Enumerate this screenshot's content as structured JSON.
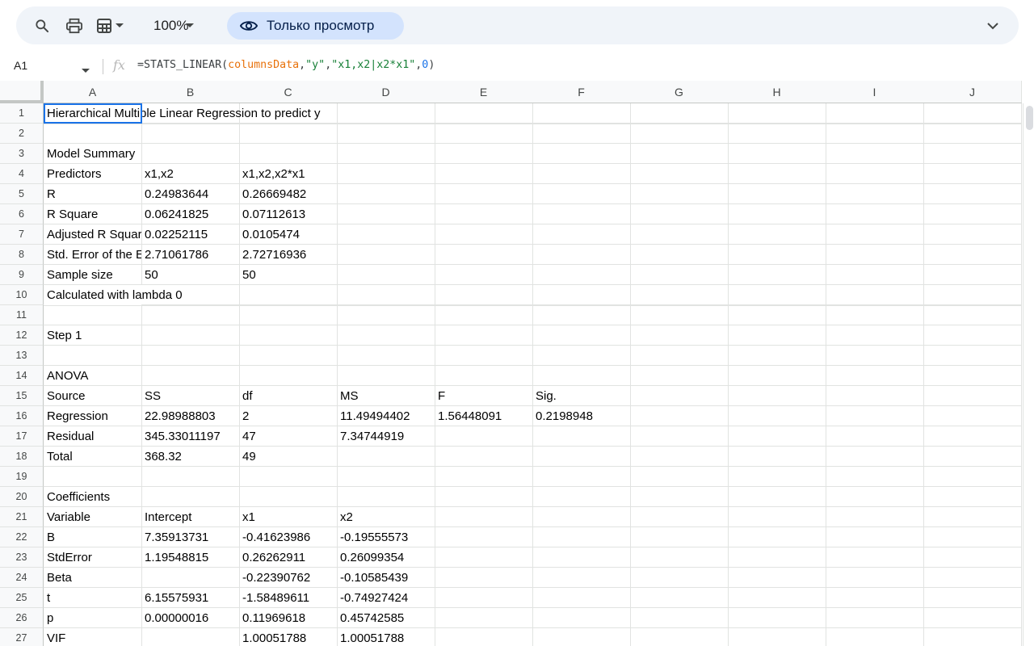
{
  "toolbar": {
    "zoom": "100%",
    "view_mode": "Только просмотр",
    "icons": [
      "search-icon",
      "print-icon",
      "format-icon",
      "chevron-down-icon"
    ]
  },
  "formula_bar": {
    "cell_ref": "A1",
    "fx": "fx",
    "formula": {
      "prefix": "=STATS_LINEAR(",
      "arg1": "columnsData",
      "sep1": ",",
      "arg2": "\"y\"",
      "sep2": ",",
      "arg3": "\"x1,x2|x2*x1\"",
      "sep3": ",",
      "arg4": "0",
      "suffix": ")"
    }
  },
  "columns": [
    "A",
    "B",
    "C",
    "D",
    "E",
    "F",
    "G",
    "H",
    "I",
    "J"
  ],
  "rows": [
    {
      "n": "1",
      "cells": [
        "Hierarchical  Multiple Linear Regression to predict y",
        "",
        "",
        "",
        "",
        ""
      ]
    },
    {
      "n": "2",
      "cells": [
        "",
        "",
        "",
        "",
        "",
        ""
      ]
    },
    {
      "n": "3",
      "cells": [
        "Model Summary",
        "",
        "",
        "",
        "",
        ""
      ]
    },
    {
      "n": "4",
      "cells": [
        "Predictors",
        "x1,x2",
        "x1,x2,x2*x1",
        "",
        "",
        ""
      ]
    },
    {
      "n": "5",
      "cells": [
        "R",
        "0.24983644",
        "0.26669482",
        "",
        "",
        ""
      ]
    },
    {
      "n": "6",
      "cells": [
        "R Square",
        "0.06241825",
        "0.07112613",
        "",
        "",
        ""
      ]
    },
    {
      "n": "7",
      "cells": [
        "Adjusted R Square",
        "0.02252115",
        "0.0105474",
        "",
        "",
        ""
      ]
    },
    {
      "n": "8",
      "cells": [
        "Std. Error of the Estimate",
        "2.71061786",
        "2.72716936",
        "",
        "",
        ""
      ]
    },
    {
      "n": "9",
      "cells": [
        "Sample size",
        "50",
        "50",
        "",
        "",
        ""
      ]
    },
    {
      "n": "10",
      "cells": [
        "Calculated with lambda 0",
        "",
        "",
        "",
        "",
        ""
      ]
    },
    {
      "n": "11",
      "cells": [
        "",
        "",
        "",
        "",
        "",
        ""
      ]
    },
    {
      "n": "12",
      "cells": [
        "Step 1",
        "",
        "",
        "",
        "",
        ""
      ]
    },
    {
      "n": "13",
      "cells": [
        "",
        "",
        "",
        "",
        "",
        ""
      ]
    },
    {
      "n": "14",
      "cells": [
        "ANOVA",
        "",
        "",
        "",
        "",
        ""
      ]
    },
    {
      "n": "15",
      "cells": [
        "Source",
        "SS",
        "df",
        "MS",
        "F",
        "Sig."
      ]
    },
    {
      "n": "16",
      "cells": [
        "Regression",
        "22.98988803",
        "2",
        "11.49494402",
        "1.56448091",
        "0.2198948"
      ]
    },
    {
      "n": "17",
      "cells": [
        "Residual",
        "345.33011197",
        "47",
        "7.34744919",
        "",
        ""
      ]
    },
    {
      "n": "18",
      "cells": [
        "Total",
        "368.32",
        "49",
        "",
        "",
        ""
      ]
    },
    {
      "n": "19",
      "cells": [
        "",
        "",
        "",
        "",
        "",
        ""
      ]
    },
    {
      "n": "20",
      "cells": [
        "Coefficients",
        "",
        "",
        "",
        "",
        ""
      ]
    },
    {
      "n": "21",
      "cells": [
        "Variable",
        "Intercept",
        "x1",
        "x2",
        "",
        ""
      ]
    },
    {
      "n": "22",
      "cells": [
        "B",
        "7.35913731",
        "-0.41623986",
        "-0.19555573",
        "",
        ""
      ]
    },
    {
      "n": "23",
      "cells": [
        "StdError",
        "1.19548815",
        "0.26262911",
        "0.26099354",
        "",
        ""
      ]
    },
    {
      "n": "24",
      "cells": [
        "Beta",
        "",
        "-0.22390762",
        "-0.10585439",
        "",
        ""
      ]
    },
    {
      "n": "25",
      "cells": [
        "t",
        "6.15575931",
        "-1.58489611",
        "-0.74927424",
        "",
        ""
      ]
    },
    {
      "n": "26",
      "cells": [
        "p",
        "0.00000016",
        "0.11969618",
        "0.45742585",
        "",
        ""
      ]
    },
    {
      "n": "27",
      "cells": [
        "VIF",
        "",
        "1.00051788",
        "1.00051788",
        "",
        ""
      ]
    }
  ]
}
